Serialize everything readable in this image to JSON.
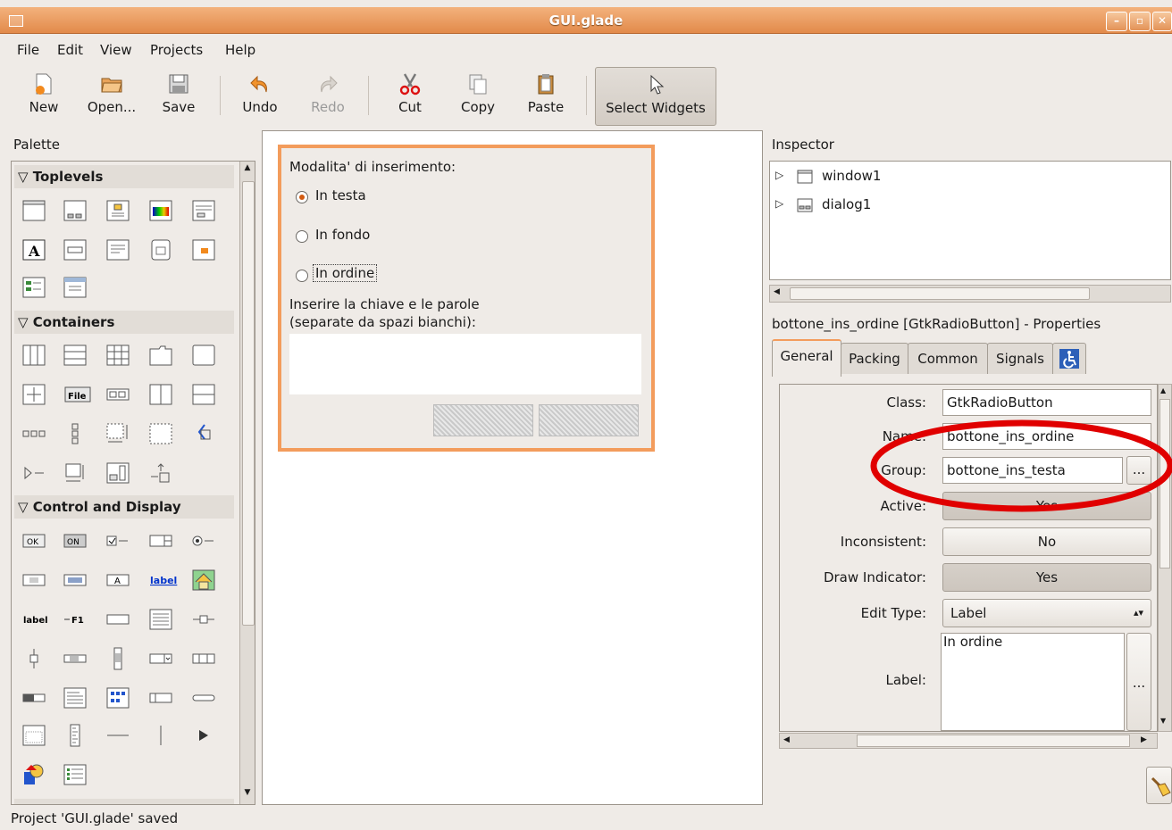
{
  "window": {
    "title": "GUI.glade"
  },
  "menu": [
    "File",
    "Edit",
    "View",
    "Projects",
    "Help"
  ],
  "toolbar": {
    "new": "New",
    "open": "Open...",
    "save": "Save",
    "undo": "Undo",
    "redo": "Redo",
    "cut": "Cut",
    "copy": "Copy",
    "paste": "Paste",
    "select_widgets": "Select Widgets"
  },
  "palette": {
    "title": "Palette",
    "groups": [
      "Toplevels",
      "Containers",
      "Control and Display"
    ]
  },
  "dialog": {
    "heading": "Modalita' di inserimento:",
    "options": [
      "In testa",
      "In fondo",
      "In ordine"
    ],
    "selected": "In testa",
    "prompt_line1": "Inserire la chiave e le parole",
    "prompt_line2": "(separate da spazi bianchi):"
  },
  "inspector": {
    "title": "Inspector",
    "tree": [
      "window1",
      "dialog1"
    ]
  },
  "properties": {
    "title": "bottone_ins_ordine [GtkRadioButton] - Properties",
    "tabs": [
      "General",
      "Packing",
      "Common",
      "Signals"
    ],
    "class_label": "Class:",
    "class_value": "GtkRadioButton",
    "name_label": "Name:",
    "name_value": "bottone_ins_ordine",
    "group_label": "Group:",
    "group_value": "bottone_ins_testa",
    "active_label": "Active:",
    "active_value": "Yes",
    "inconsistent_label": "Inconsistent:",
    "inconsistent_value": "No",
    "draw_label": "Draw Indicator:",
    "draw_value": "Yes",
    "edittype_label": "Edit Type:",
    "edittype_value": "Label",
    "label_label": "Label:",
    "label_value": "In ordine",
    "ellipsis": "..."
  },
  "palette_icons": {
    "file": "File",
    "label": "label",
    "label_link": "label",
    "f1": "F1",
    "ok": "OK",
    "on": "ON",
    "a": "A"
  },
  "status": "Project 'GUI.glade' saved",
  "colors": {
    "accent": "#f39c5c",
    "highlight": "#e00000",
    "titlebar": "#e28a4a"
  }
}
